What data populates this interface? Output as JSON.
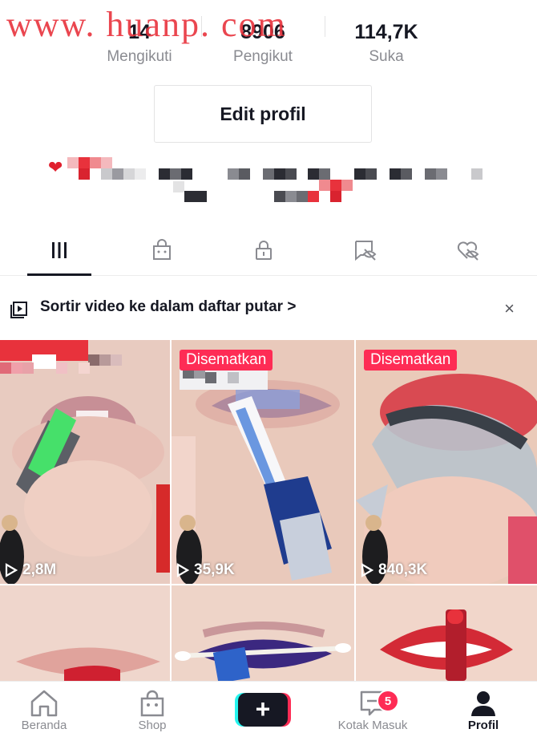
{
  "watermark": "www. huanp. com",
  "stats": [
    {
      "number": "14",
      "label": "Mengikuti"
    },
    {
      "number": "8906",
      "label": "Pengikut"
    },
    {
      "number": "114,7K",
      "label": "Suka"
    }
  ],
  "edit_profile_label": "Edit profil",
  "tabs": [
    {
      "name": "videos",
      "icon": "grid-icon",
      "active": true
    },
    {
      "name": "shop",
      "icon": "shopping-bag-icon",
      "active": false
    },
    {
      "name": "private",
      "icon": "lock-icon",
      "active": false
    },
    {
      "name": "reposts",
      "icon": "hidden-tag-icon",
      "active": false
    },
    {
      "name": "liked",
      "icon": "hidden-heart-icon",
      "active": false
    }
  ],
  "playlist_prompt": {
    "text": "Sortir video ke dalam daftar putar",
    "chevron": ">",
    "close": "×"
  },
  "videos": [
    {
      "pinned_label": "",
      "views": "2,8M"
    },
    {
      "pinned_label": "Disematkan",
      "views": "35,9K"
    },
    {
      "pinned_label": "Disematkan",
      "views": "840,3K"
    },
    {
      "pinned_label": "",
      "views": ""
    },
    {
      "pinned_label": "",
      "views": ""
    },
    {
      "pinned_label": "",
      "views": ""
    }
  ],
  "bottom_nav": {
    "home": "Beranda",
    "shop": "Shop",
    "create": "+",
    "inbox": "Kotak Masuk",
    "inbox_badge": "5",
    "profile": "Profil"
  },
  "colors": {
    "accent": "#fe2c55",
    "text": "#161823",
    "muted": "#8a8b91",
    "divider": "#e3e3e4"
  }
}
